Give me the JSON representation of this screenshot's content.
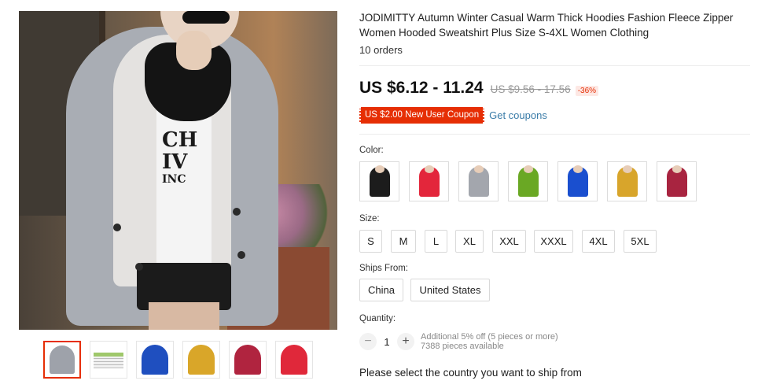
{
  "product": {
    "title": "JODIMITTY Autumn Winter Casual Warm Thick Hoodies Fashion Fleece Zipper Women Hooded Sweatshirt Plus Size S-4XL Women Clothing",
    "orders": "10 orders",
    "price_range": "US $6.12 - 11.24",
    "original_price_range": "US $9.56 - 17.56",
    "discount": "-36%",
    "coupon_label": "US $2.00 New User Coupon",
    "get_coupons_label": "Get coupons"
  },
  "gallery": {
    "thumbnails": [
      {
        "name": "gray",
        "color": "#9ea2aa",
        "active": true
      },
      {
        "name": "size-chart",
        "color": "#f0f0f0",
        "active": false
      },
      {
        "name": "blue",
        "color": "#1f4fbf",
        "active": false
      },
      {
        "name": "yellow",
        "color": "#d9a629",
        "active": false
      },
      {
        "name": "wine",
        "color": "#b0243f",
        "active": false
      },
      {
        "name": "red",
        "color": "#e0283a",
        "active": false
      }
    ],
    "main_image_text": [
      "CH",
      "IV",
      "INC"
    ]
  },
  "color": {
    "label": "Color:",
    "options": [
      {
        "name": "black",
        "color": "#1c1c1c"
      },
      {
        "name": "red",
        "color": "#e3263b"
      },
      {
        "name": "gray",
        "color": "#a3a6ad"
      },
      {
        "name": "green",
        "color": "#6aa824"
      },
      {
        "name": "blue",
        "color": "#1a4fcf"
      },
      {
        "name": "yellow",
        "color": "#d8a52b"
      },
      {
        "name": "wine",
        "color": "#a82440"
      }
    ]
  },
  "size": {
    "label": "Size:",
    "options": [
      "S",
      "M",
      "L",
      "XL",
      "XXL",
      "XXXL",
      "4XL",
      "5XL"
    ]
  },
  "ships_from": {
    "label": "Ships From:",
    "options": [
      "China",
      "United States"
    ]
  },
  "quantity": {
    "label": "Quantity:",
    "minus": "−",
    "plus": "+",
    "value": "1",
    "note": "Additional 5% off (5 pieces or more)",
    "available": "7388 pieces available"
  },
  "ship_message": "Please select the country you want to ship from"
}
